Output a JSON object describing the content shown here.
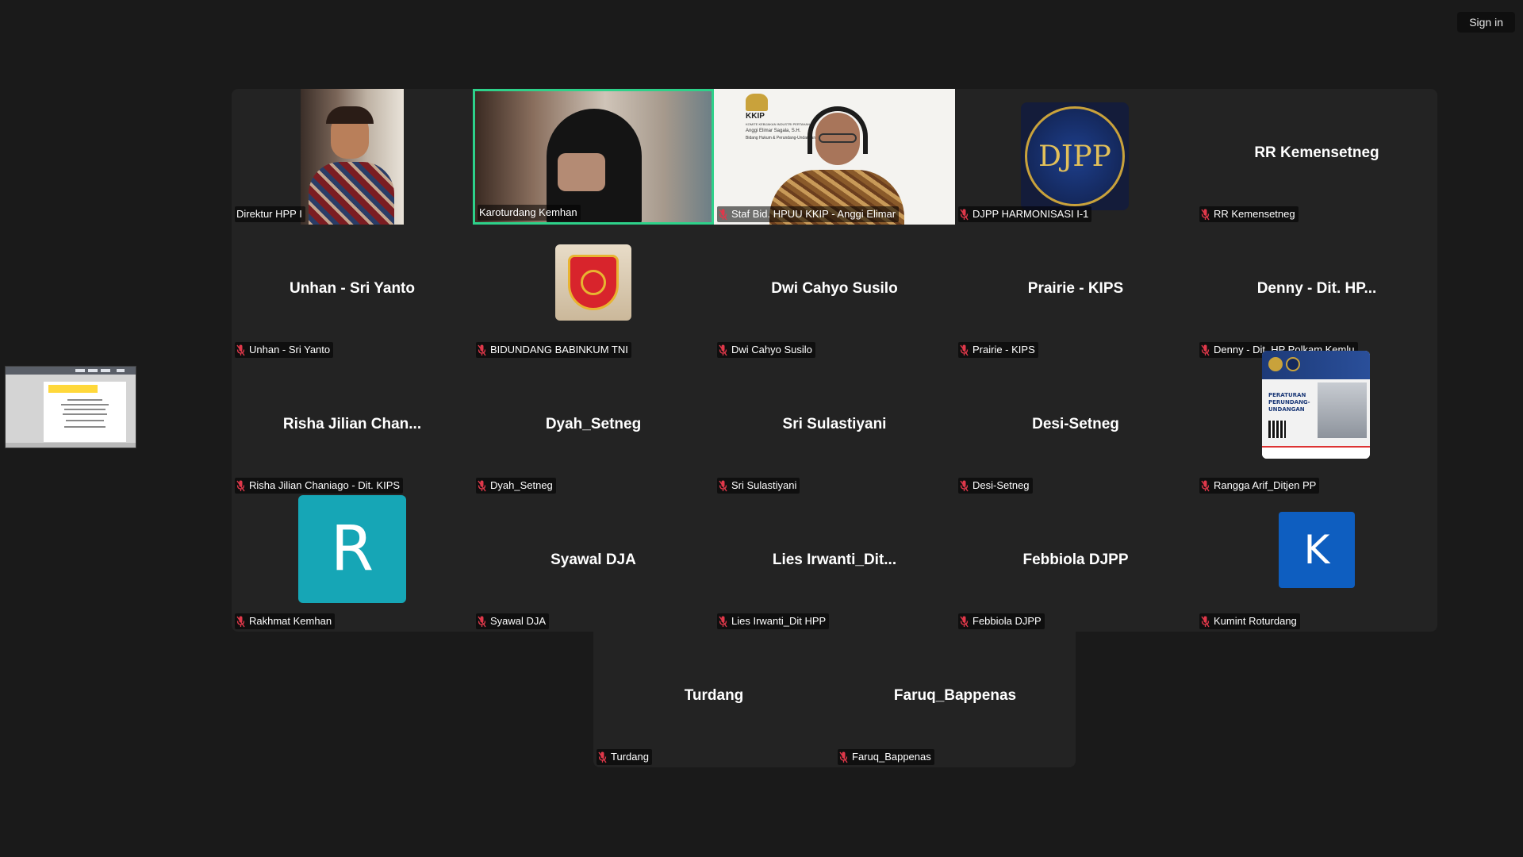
{
  "header": {
    "sign_in_label": "Sign in"
  },
  "colors": {
    "active_speaker_border": "#2ed18a",
    "muted_mic": "#e0384a",
    "avatar_r": "#16a6b6",
    "avatar_k": "#0e5ec0"
  },
  "tiles": [
    {
      "display_name": "Direktur HPP I"
    },
    {
      "display_name": "Karoturdang Kemhan"
    },
    {
      "display_name": "Staf Bid. HPUU KKIP - Anggi Elimar",
      "video_caption": {
        "org": "KKIP",
        "line1": "KOMITE KEBIJAKAN INDUSTRI PERTAHANAN",
        "line2": "Anggi Elimar Sagala, S.H.",
        "line3": "Bidang Hukum & Perundang-Undangan"
      }
    },
    {
      "display_name": "DJPP HARMONISASI I-1",
      "logo_text": "DJPP"
    },
    {
      "display_name": "RR Kemensetneg",
      "big_name": "RR Kemensetneg"
    },
    {
      "display_name": "Unhan - Sri Yanto",
      "big_name": "Unhan - Sri Yanto"
    },
    {
      "display_name": "BIDUNDANG BABINKUM TNI"
    },
    {
      "display_name": "Dwi Cahyo Susilo",
      "big_name": "Dwi Cahyo Susilo"
    },
    {
      "display_name": "Prairie - KIPS",
      "big_name": "Prairie - KIPS"
    },
    {
      "display_name": "Denny - Dit. HP Polkam Kemlu",
      "big_name": "Denny - Dit. HP..."
    },
    {
      "display_name": "Risha Jilian Chaniago - Dit. KIPS",
      "big_name": "Risha Jilian Chan..."
    },
    {
      "display_name": "Dyah_Setneg",
      "big_name": "Dyah_Setneg"
    },
    {
      "display_name": "Sri Sulastiyani",
      "big_name": "Sri Sulastiyani"
    },
    {
      "display_name": "Desi-Setneg",
      "big_name": "Desi-Setneg"
    },
    {
      "display_name": "Rangga Arif_Ditjen PP",
      "poster_text": "PERATURAN PERUNDANG-UNDANGAN"
    },
    {
      "display_name": "Rakhmat Kemhan",
      "avatar_letter": "R"
    },
    {
      "display_name": "Syawal DJA",
      "big_name": "Syawal DJA"
    },
    {
      "display_name": "Lies Irwanti_Dit HPP",
      "big_name": "Lies Irwanti_Dit..."
    },
    {
      "display_name": "Febbiola DJPP",
      "big_name": "Febbiola DJPP"
    },
    {
      "display_name": "Kumint Roturdang",
      "avatar_letter": "K"
    },
    {
      "display_name": "Turdang",
      "big_name": "Turdang"
    },
    {
      "display_name": "Faruq_Bappenas",
      "big_name": "Faruq_Bappenas"
    }
  ]
}
